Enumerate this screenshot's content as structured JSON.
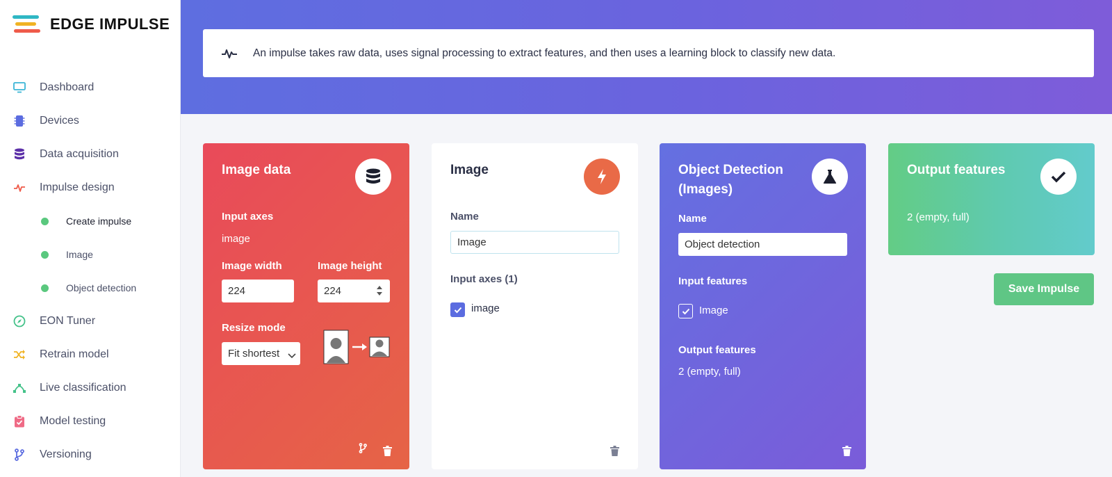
{
  "app": {
    "brand": "EDGE IMPULSE"
  },
  "sidebar": {
    "items": [
      {
        "label": "Dashboard",
        "icon": "monitor-icon",
        "color": "#3bb5d6"
      },
      {
        "label": "Devices",
        "icon": "chip-icon",
        "color": "#5b6ce0"
      },
      {
        "label": "Data acquisition",
        "icon": "database-icon",
        "color": "#5b2fa8"
      },
      {
        "label": "Impulse design",
        "icon": "pulse-icon",
        "color": "#ef5b4a"
      },
      {
        "label": "EON Tuner",
        "icon": "compass-icon",
        "color": "#45c28a"
      },
      {
        "label": "Retrain model",
        "icon": "shuffle-icon",
        "color": "#f0b323"
      },
      {
        "label": "Live classification",
        "icon": "bezier-icon",
        "color": "#45c28a"
      },
      {
        "label": "Model testing",
        "icon": "clipboard-check-icon",
        "color": "#ef6b86"
      },
      {
        "label": "Versioning",
        "icon": "git-branch-icon",
        "color": "#5b6ce0"
      }
    ],
    "sub_items": [
      {
        "label": "Create impulse"
      },
      {
        "label": "Image"
      },
      {
        "label": "Object detection"
      }
    ]
  },
  "header": {
    "info": "An impulse takes raw data, uses signal processing to extract features, and then uses a learning block to classify new data."
  },
  "image_data_card": {
    "title": "Image data",
    "input_axes_label": "Input axes",
    "input_axes_value": "image",
    "width_label": "Image width",
    "width_value": "224",
    "height_label": "Image height",
    "height_value": "224",
    "resize_label": "Resize mode",
    "resize_value": "Fit shortest"
  },
  "image_card": {
    "title": "Image",
    "name_label": "Name",
    "name_value": "Image",
    "input_axes_label": "Input axes (1)",
    "axis_option": "image"
  },
  "object_detection_card": {
    "title_line1": "Object Detection",
    "title_line2": "(Images)",
    "name_label": "Name",
    "name_value": "Object detection",
    "input_features_label": "Input features",
    "input_feature_option": "Image",
    "output_features_label": "Output features",
    "output_features_value": "2 (empty, full)"
  },
  "output_card": {
    "title": "Output features",
    "value": "2 (empty, full)"
  },
  "save_button": {
    "label": "Save Impulse"
  }
}
